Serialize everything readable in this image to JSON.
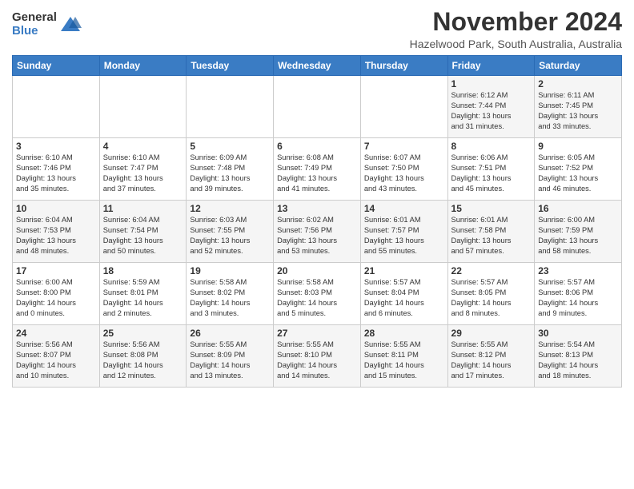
{
  "logo": {
    "general": "General",
    "blue": "Blue"
  },
  "header": {
    "month": "November 2024",
    "location": "Hazelwood Park, South Australia, Australia"
  },
  "weekdays": [
    "Sunday",
    "Monday",
    "Tuesday",
    "Wednesday",
    "Thursday",
    "Friday",
    "Saturday"
  ],
  "weeks": [
    [
      {
        "day": "",
        "info": ""
      },
      {
        "day": "",
        "info": ""
      },
      {
        "day": "",
        "info": ""
      },
      {
        "day": "",
        "info": ""
      },
      {
        "day": "",
        "info": ""
      },
      {
        "day": "1",
        "info": "Sunrise: 6:12 AM\nSunset: 7:44 PM\nDaylight: 13 hours\nand 31 minutes."
      },
      {
        "day": "2",
        "info": "Sunrise: 6:11 AM\nSunset: 7:45 PM\nDaylight: 13 hours\nand 33 minutes."
      }
    ],
    [
      {
        "day": "3",
        "info": "Sunrise: 6:10 AM\nSunset: 7:46 PM\nDaylight: 13 hours\nand 35 minutes."
      },
      {
        "day": "4",
        "info": "Sunrise: 6:10 AM\nSunset: 7:47 PM\nDaylight: 13 hours\nand 37 minutes."
      },
      {
        "day": "5",
        "info": "Sunrise: 6:09 AM\nSunset: 7:48 PM\nDaylight: 13 hours\nand 39 minutes."
      },
      {
        "day": "6",
        "info": "Sunrise: 6:08 AM\nSunset: 7:49 PM\nDaylight: 13 hours\nand 41 minutes."
      },
      {
        "day": "7",
        "info": "Sunrise: 6:07 AM\nSunset: 7:50 PM\nDaylight: 13 hours\nand 43 minutes."
      },
      {
        "day": "8",
        "info": "Sunrise: 6:06 AM\nSunset: 7:51 PM\nDaylight: 13 hours\nand 45 minutes."
      },
      {
        "day": "9",
        "info": "Sunrise: 6:05 AM\nSunset: 7:52 PM\nDaylight: 13 hours\nand 46 minutes."
      }
    ],
    [
      {
        "day": "10",
        "info": "Sunrise: 6:04 AM\nSunset: 7:53 PM\nDaylight: 13 hours\nand 48 minutes."
      },
      {
        "day": "11",
        "info": "Sunrise: 6:04 AM\nSunset: 7:54 PM\nDaylight: 13 hours\nand 50 minutes."
      },
      {
        "day": "12",
        "info": "Sunrise: 6:03 AM\nSunset: 7:55 PM\nDaylight: 13 hours\nand 52 minutes."
      },
      {
        "day": "13",
        "info": "Sunrise: 6:02 AM\nSunset: 7:56 PM\nDaylight: 13 hours\nand 53 minutes."
      },
      {
        "day": "14",
        "info": "Sunrise: 6:01 AM\nSunset: 7:57 PM\nDaylight: 13 hours\nand 55 minutes."
      },
      {
        "day": "15",
        "info": "Sunrise: 6:01 AM\nSunset: 7:58 PM\nDaylight: 13 hours\nand 57 minutes."
      },
      {
        "day": "16",
        "info": "Sunrise: 6:00 AM\nSunset: 7:59 PM\nDaylight: 13 hours\nand 58 minutes."
      }
    ],
    [
      {
        "day": "17",
        "info": "Sunrise: 6:00 AM\nSunset: 8:00 PM\nDaylight: 14 hours\nand 0 minutes."
      },
      {
        "day": "18",
        "info": "Sunrise: 5:59 AM\nSunset: 8:01 PM\nDaylight: 14 hours\nand 2 minutes."
      },
      {
        "day": "19",
        "info": "Sunrise: 5:58 AM\nSunset: 8:02 PM\nDaylight: 14 hours\nand 3 minutes."
      },
      {
        "day": "20",
        "info": "Sunrise: 5:58 AM\nSunset: 8:03 PM\nDaylight: 14 hours\nand 5 minutes."
      },
      {
        "day": "21",
        "info": "Sunrise: 5:57 AM\nSunset: 8:04 PM\nDaylight: 14 hours\nand 6 minutes."
      },
      {
        "day": "22",
        "info": "Sunrise: 5:57 AM\nSunset: 8:05 PM\nDaylight: 14 hours\nand 8 minutes."
      },
      {
        "day": "23",
        "info": "Sunrise: 5:57 AM\nSunset: 8:06 PM\nDaylight: 14 hours\nand 9 minutes."
      }
    ],
    [
      {
        "day": "24",
        "info": "Sunrise: 5:56 AM\nSunset: 8:07 PM\nDaylight: 14 hours\nand 10 minutes."
      },
      {
        "day": "25",
        "info": "Sunrise: 5:56 AM\nSunset: 8:08 PM\nDaylight: 14 hours\nand 12 minutes."
      },
      {
        "day": "26",
        "info": "Sunrise: 5:55 AM\nSunset: 8:09 PM\nDaylight: 14 hours\nand 13 minutes."
      },
      {
        "day": "27",
        "info": "Sunrise: 5:55 AM\nSunset: 8:10 PM\nDaylight: 14 hours\nand 14 minutes."
      },
      {
        "day": "28",
        "info": "Sunrise: 5:55 AM\nSunset: 8:11 PM\nDaylight: 14 hours\nand 15 minutes."
      },
      {
        "day": "29",
        "info": "Sunrise: 5:55 AM\nSunset: 8:12 PM\nDaylight: 14 hours\nand 17 minutes."
      },
      {
        "day": "30",
        "info": "Sunrise: 5:54 AM\nSunset: 8:13 PM\nDaylight: 14 hours\nand 18 minutes."
      }
    ]
  ]
}
